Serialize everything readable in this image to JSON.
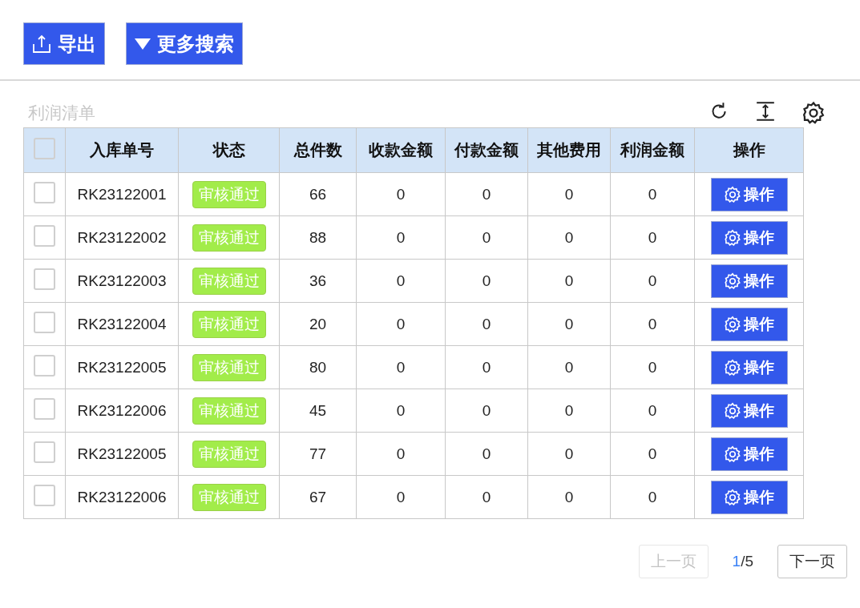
{
  "toolbar": {
    "buttons": [
      {
        "kind": "export",
        "label": "导出"
      },
      {
        "kind": "more",
        "label": "更多搜索"
      }
    ]
  },
  "table": {
    "title": "利润清单",
    "select_all": {
      "checked": false
    },
    "columns": [
      "入库单号",
      "状态",
      "总件数",
      "收款金额",
      "付款金额",
      "其他费用",
      "利润金额",
      "操作"
    ],
    "rows": [
      {
        "checked": false,
        "order_no": "RK23122001",
        "status": {
          "label": "审核通过",
          "kind": "approved"
        },
        "total": "66",
        "received": "0",
        "paid": "0",
        "other": "0",
        "profit": "0",
        "action": "操作"
      },
      {
        "checked": false,
        "order_no": "RK23122002",
        "status": {
          "label": "审核通过",
          "kind": "approved"
        },
        "total": "88",
        "received": "0",
        "paid": "0",
        "other": "0",
        "profit": "0",
        "action": "操作"
      },
      {
        "checked": false,
        "order_no": "RK23122003",
        "status": {
          "label": "审核通过",
          "kind": "approved"
        },
        "total": "36",
        "received": "0",
        "paid": "0",
        "other": "0",
        "profit": "0",
        "action": "操作"
      },
      {
        "checked": false,
        "order_no": "RK23122004",
        "status": {
          "label": "审核通过",
          "kind": "approved"
        },
        "total": "20",
        "received": "0",
        "paid": "0",
        "other": "0",
        "profit": "0",
        "action": "操作"
      },
      {
        "checked": false,
        "order_no": "RK23122005",
        "status": {
          "label": "审核通过",
          "kind": "approved"
        },
        "total": "80",
        "received": "0",
        "paid": "0",
        "other": "0",
        "profit": "0",
        "action": "操作"
      },
      {
        "checked": false,
        "order_no": "RK23122006",
        "status": {
          "label": "审核通过",
          "kind": "approved"
        },
        "total": "45",
        "received": "0",
        "paid": "0",
        "other": "0",
        "profit": "0",
        "action": "操作"
      },
      {
        "checked": false,
        "order_no": "RK23122005",
        "status": {
          "label": "审核通过",
          "kind": "approved"
        },
        "total": "77",
        "received": "0",
        "paid": "0",
        "other": "0",
        "profit": "0",
        "action": "操作"
      },
      {
        "checked": false,
        "order_no": "RK23122006",
        "status": {
          "label": "审核通过",
          "kind": "approved"
        },
        "total": "67",
        "received": "0",
        "paid": "0",
        "other": "0",
        "profit": "0",
        "action": "操作"
      }
    ]
  },
  "pagination": {
    "prev": {
      "label": "上一页",
      "disabled": true
    },
    "current": "1",
    "rest": "/5",
    "next": {
      "label": "下一页",
      "disabled": false
    }
  }
}
